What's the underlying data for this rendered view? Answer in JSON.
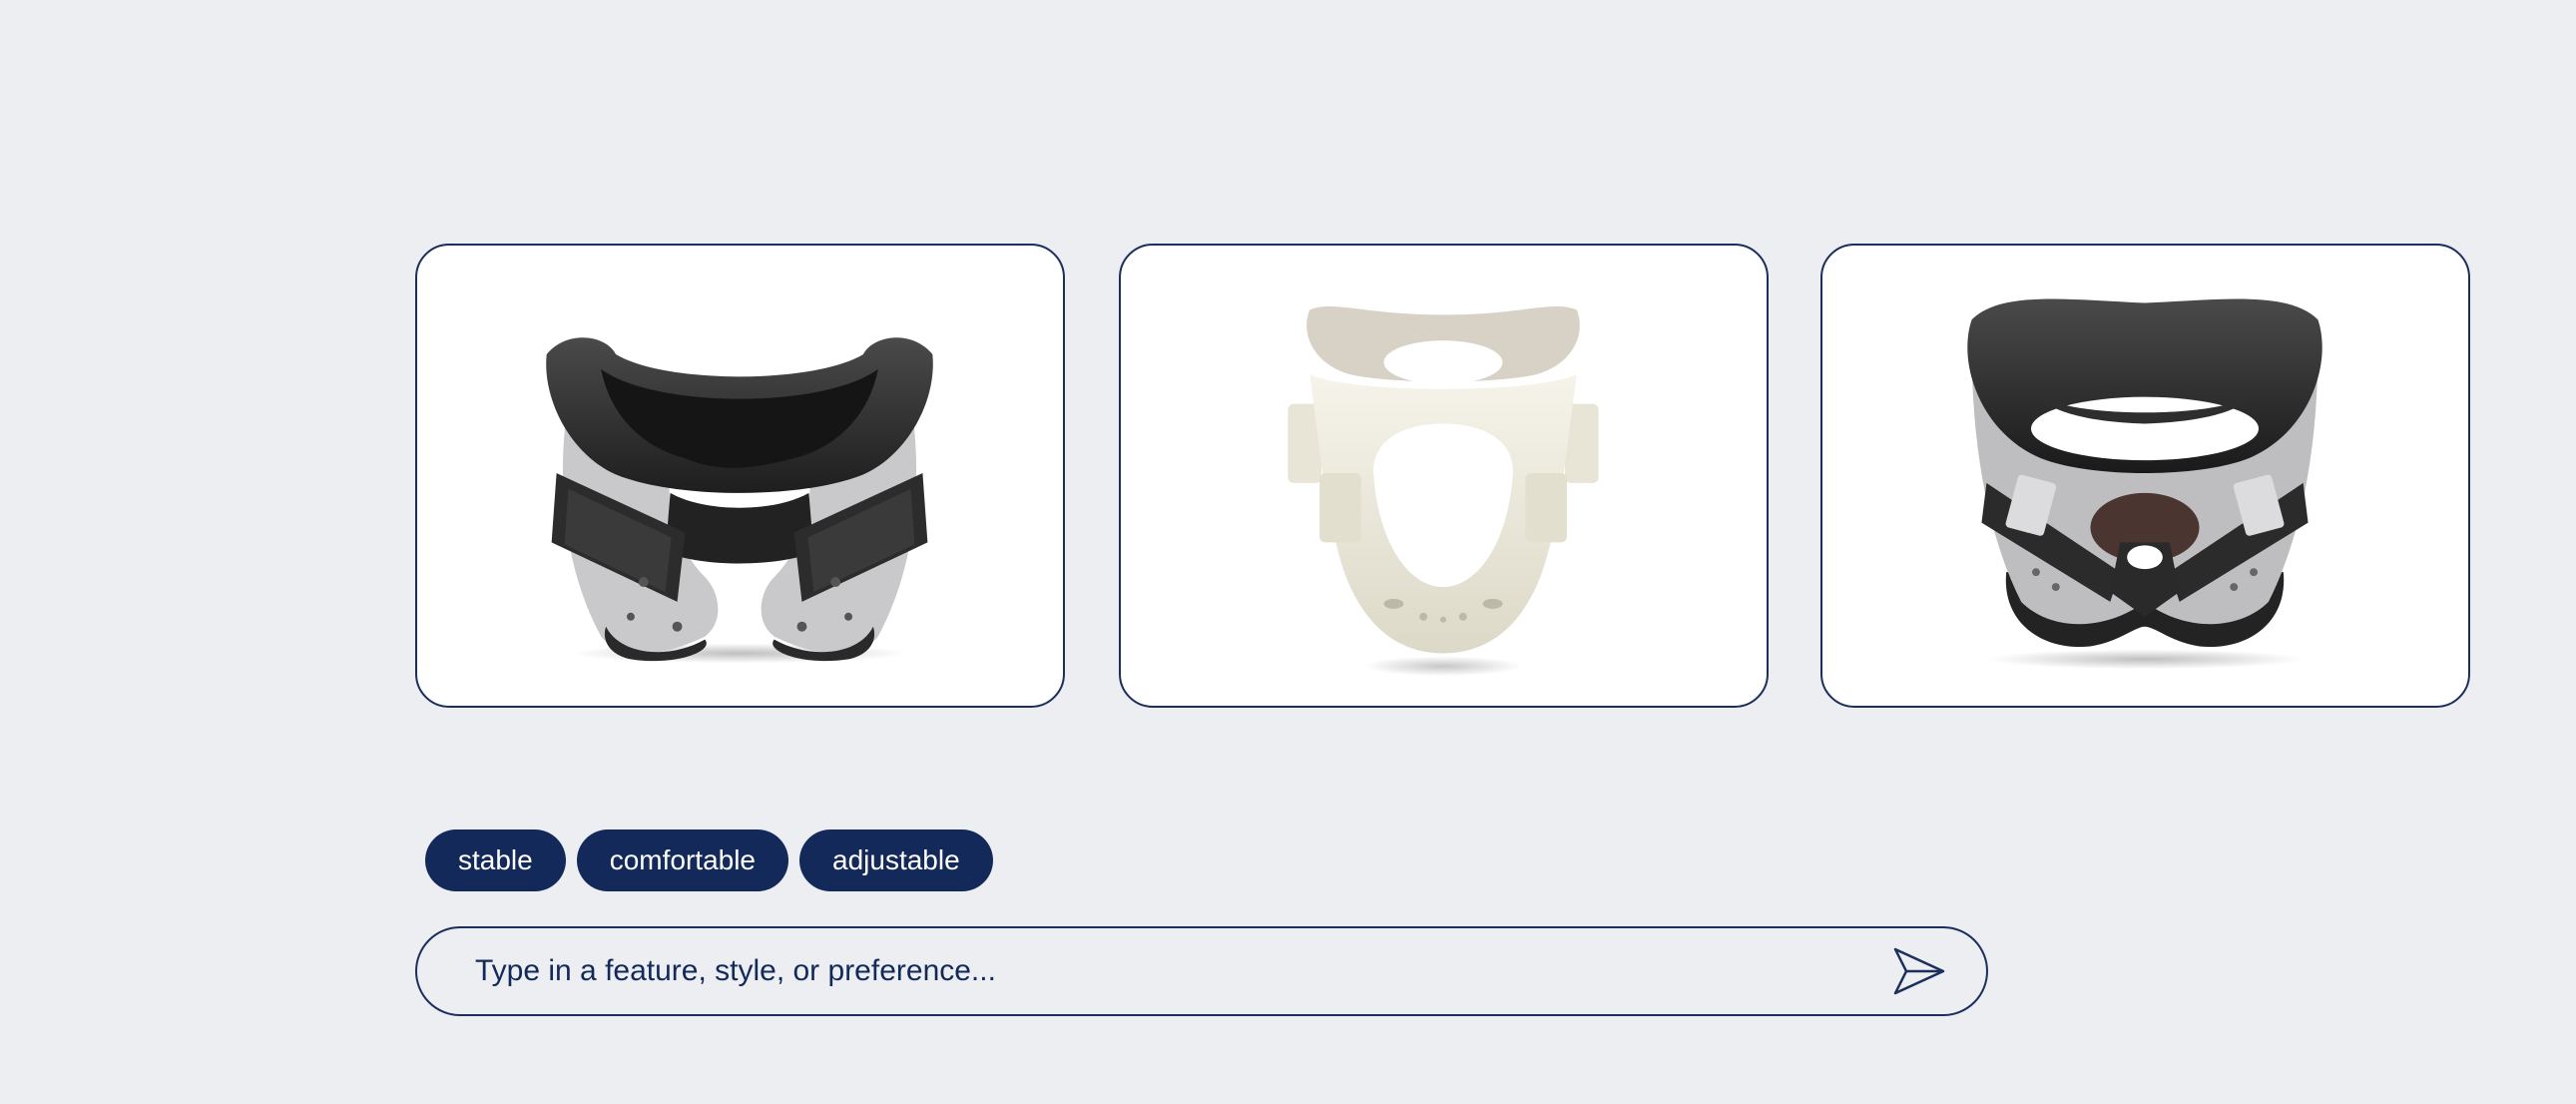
{
  "products": [
    {
      "id": "collar-black-gray-velcro",
      "icon": "cervical-collar-black-gray-image"
    },
    {
      "id": "collar-cream-rigid",
      "icon": "cervical-collar-cream-image"
    },
    {
      "id": "collar-black-gray-padded",
      "icon": "cervical-collar-padded-image"
    }
  ],
  "chips": [
    "stable",
    "comfortable",
    "adjustable"
  ],
  "input": {
    "placeholder": "Type in a feature, style, or preference..."
  },
  "send": {
    "icon": "send-arrow-icon"
  },
  "colors": {
    "accent": "#13295a",
    "background": "#eceef2",
    "card": "#ffffff",
    "border": "#1b2e5c"
  }
}
